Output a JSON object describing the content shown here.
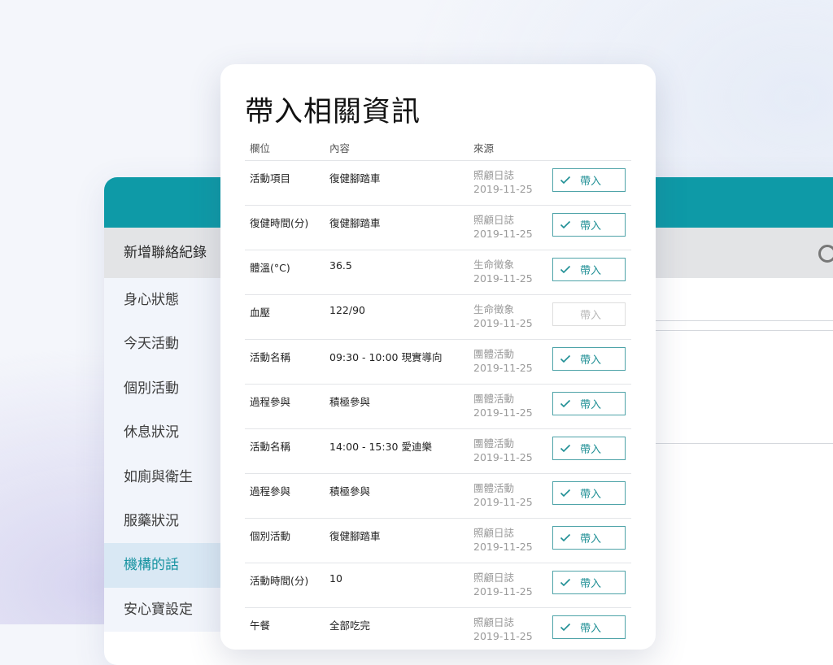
{
  "background_app": {
    "toolbar_button": "新增聯絡紀錄",
    "sidebar": [
      {
        "label": "身心狀態",
        "active": false
      },
      {
        "label": "今天活動",
        "active": false
      },
      {
        "label": "個別活動",
        "active": false
      },
      {
        "label": "休息狀況",
        "active": false
      },
      {
        "label": "如廁與衛生",
        "active": false
      },
      {
        "label": "服藥狀況",
        "active": false
      },
      {
        "label": "機構的話",
        "active": true
      },
      {
        "label": "安心寶設定",
        "active": false
      }
    ]
  },
  "dialog": {
    "title": "帶入相關資訊",
    "columns": {
      "field": "欄位",
      "content": "內容",
      "source": "來源"
    },
    "rows": [
      {
        "field": "活動項目",
        "content": "復健腳踏車",
        "source": "照顧日誌",
        "date": "2019-11-25",
        "action": "帶入",
        "enabled": true
      },
      {
        "field": "復健時間(分)",
        "content": "復健腳踏車",
        "source": "照顧日誌",
        "date": "2019-11-25",
        "action": "帶入",
        "enabled": true
      },
      {
        "field": "體溫(°C)",
        "content": "36.5",
        "source": "生命徵象",
        "date": "2019-11-25",
        "action": "帶入",
        "enabled": true
      },
      {
        "field": "血壓",
        "content": "122/90",
        "source": "生命徵象",
        "date": "2019-11-25",
        "action": "帶入",
        "enabled": false
      },
      {
        "field": "活動名稱",
        "content": "09:30 - 10:00 現實導向",
        "source": "團體活動",
        "date": "2019-11-25",
        "action": "帶入",
        "enabled": true
      },
      {
        "field": "過程參與",
        "content": "積極參與",
        "source": "團體活動",
        "date": "2019-11-25",
        "action": "帶入",
        "enabled": true
      },
      {
        "field": "活動名稱",
        "content": "14:00 - 15:30 愛迪樂",
        "source": "團體活動",
        "date": "2019-11-25",
        "action": "帶入",
        "enabled": true
      },
      {
        "field": "過程參與",
        "content": "積極參與",
        "source": "團體活動",
        "date": "2019-11-25",
        "action": "帶入",
        "enabled": true
      },
      {
        "field": "個別活動",
        "content": "復健腳踏車",
        "source": "照顧日誌",
        "date": "2019-11-25",
        "action": "帶入",
        "enabled": true
      },
      {
        "field": "活動時間(分)",
        "content": "10",
        "source": "照顧日誌",
        "date": "2019-11-25",
        "action": "帶入",
        "enabled": true
      },
      {
        "field": "午餐",
        "content": "全部吃完",
        "source": "照顧日誌",
        "date": "2019-11-25",
        "action": "帶入",
        "enabled": true
      }
    ]
  },
  "colors": {
    "accent": "#0e9aa7",
    "button_border": "#4ea3a8",
    "button_text": "#1f8f95",
    "active_nav_bg": "#d9e8f4"
  }
}
